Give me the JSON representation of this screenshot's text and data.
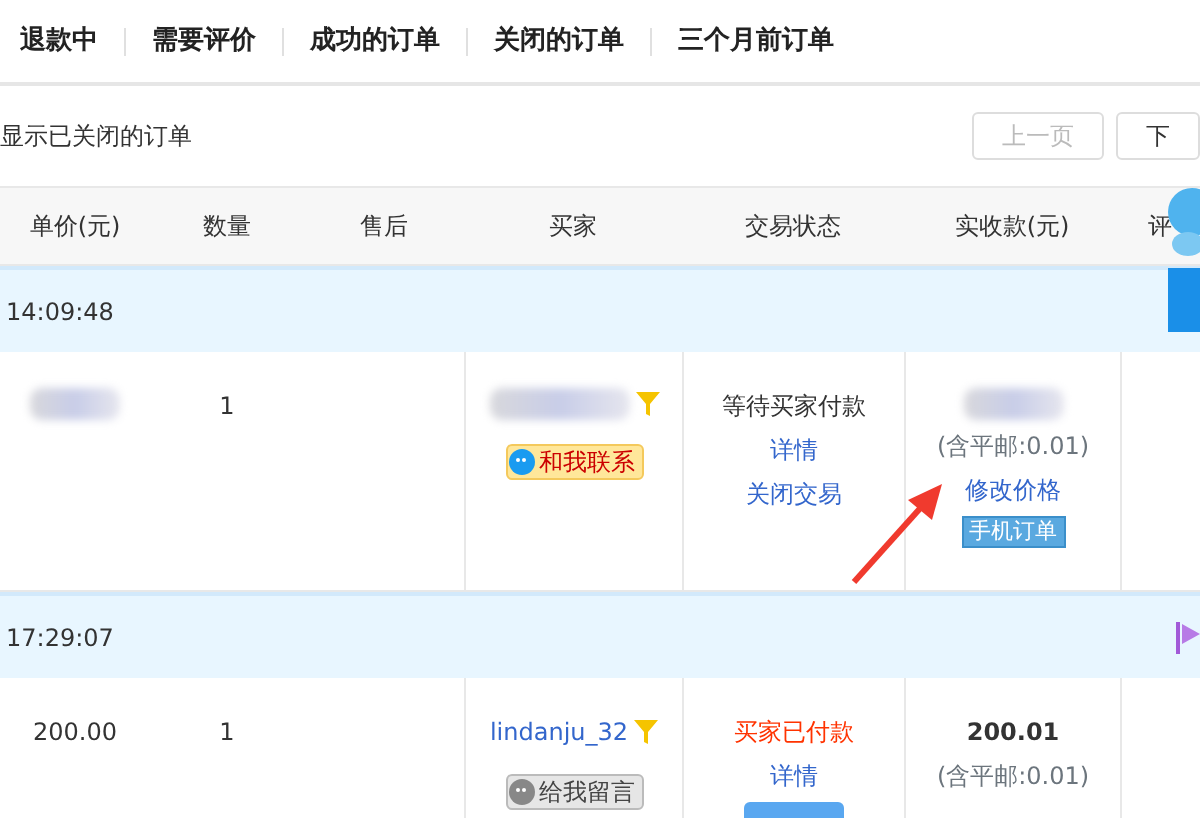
{
  "tabs": [
    {
      "label": "退款中"
    },
    {
      "label": "需要评价"
    },
    {
      "label": "成功的订单"
    },
    {
      "label": "关闭的订单"
    },
    {
      "label": "三个月前订单"
    }
  ],
  "filter": {
    "label": "显示已关闭的订单"
  },
  "pager": {
    "prev": {
      "label": "上一页",
      "disabled": true
    },
    "next": {
      "label": "下",
      "disabled": false
    }
  },
  "columns": [
    "单价(元)",
    "数量",
    "售后",
    "买家",
    "交易状态",
    "实收款(元)",
    "评"
  ],
  "orders": [
    {
      "time": "14:09:48",
      "flagged": false,
      "unit_price": {
        "blurred": true
      },
      "quantity": "1",
      "buyer": {
        "blurred": true,
        "contact": {
          "label": "和我联系",
          "online": true
        }
      },
      "status": {
        "text": "等待买家付款",
        "kind": "waiting"
      },
      "links": [
        "详情",
        "关闭交易"
      ],
      "extra_button": false,
      "amount": {
        "blurred": true
      },
      "postage": "(含平邮:0.01)",
      "amount_links": [
        "修改价格"
      ],
      "mobile_badge": "手机订单",
      "annotation_arrow": true
    },
    {
      "time": "17:29:07",
      "flagged": true,
      "unit_price": {
        "text": "200.00"
      },
      "quantity": "1",
      "buyer": {
        "name": "lindanju_32",
        "contact": {
          "label": "给我留言",
          "online": false
        }
      },
      "status": {
        "text": "买家已付款",
        "kind": "paid"
      },
      "links": [
        "详情"
      ],
      "extra_button": true,
      "amount": {
        "text": "200.01"
      },
      "postage": "(含平邮:0.01)",
      "annotation_arrow": false
    }
  ]
}
